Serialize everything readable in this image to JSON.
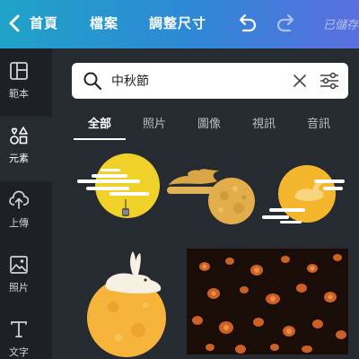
{
  "topbar": {
    "home_label": "首頁",
    "file_label": "檔案",
    "resize_label": "調整尺寸",
    "saved_label": "已儲存"
  },
  "rail": {
    "items": [
      {
        "label": "範本",
        "icon": "template-icon"
      },
      {
        "label": "元素",
        "icon": "elements-icon"
      },
      {
        "label": "上傳",
        "icon": "upload-icon"
      },
      {
        "label": "照片",
        "icon": "photo-icon"
      },
      {
        "label": "文字",
        "icon": "text-icon"
      }
    ]
  },
  "search": {
    "value": "中秋節"
  },
  "tabs": [
    "全部",
    "照片",
    "圖像",
    "視訊",
    "音訊"
  ],
  "colors": {
    "accent_start": "#1fa3c8",
    "accent_end": "#5b6fe0",
    "moon_yellow": "#f3d22b",
    "moon_orange": "#f5b52e"
  }
}
